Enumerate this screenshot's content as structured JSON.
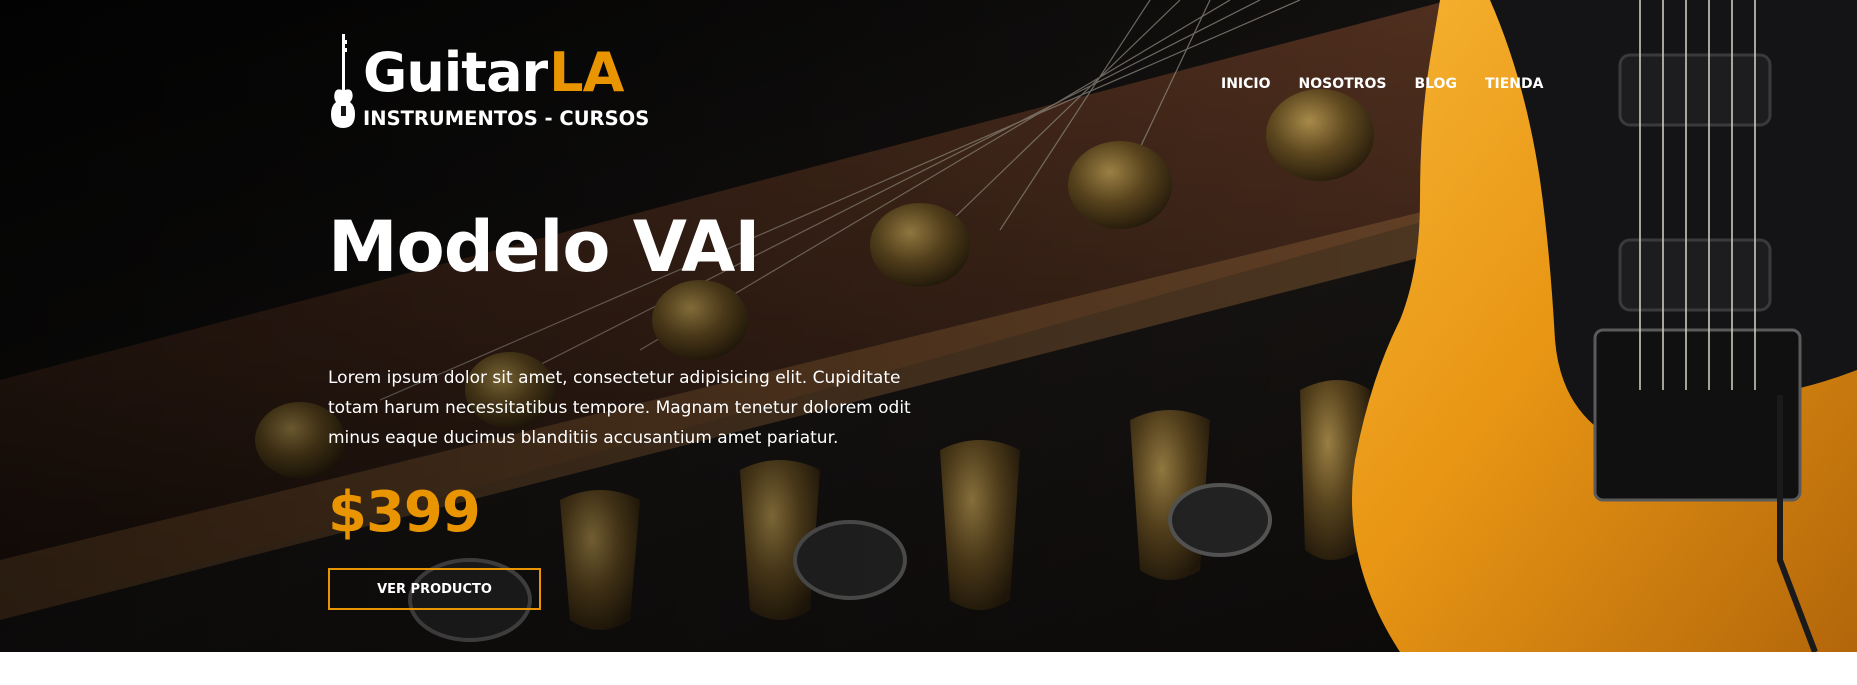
{
  "logo": {
    "word_main": "Guitar",
    "word_accent": "LA",
    "tagline": "INSTRUMENTOS - CURSOS",
    "icon": "electric-guitar-icon"
  },
  "nav": {
    "items": [
      {
        "label": "INICIO"
      },
      {
        "label": "NOSOTROS"
      },
      {
        "label": "BLOG"
      },
      {
        "label": "TIENDA"
      }
    ]
  },
  "hero": {
    "title": "Modelo VAI",
    "description": "Lorem ipsum dolor sit amet, consectetur adipisicing elit. Cupiditate totam harum necessitatibus tempore. Magnam tenetur dolorem odit minus eaque ducimus blanditiis accusantium amet pariatur.",
    "price": "$399",
    "cta_label": "VER PRODUCTO"
  },
  "colors": {
    "accent": "#e99401",
    "text": "#ffffff",
    "background": "#161412"
  }
}
